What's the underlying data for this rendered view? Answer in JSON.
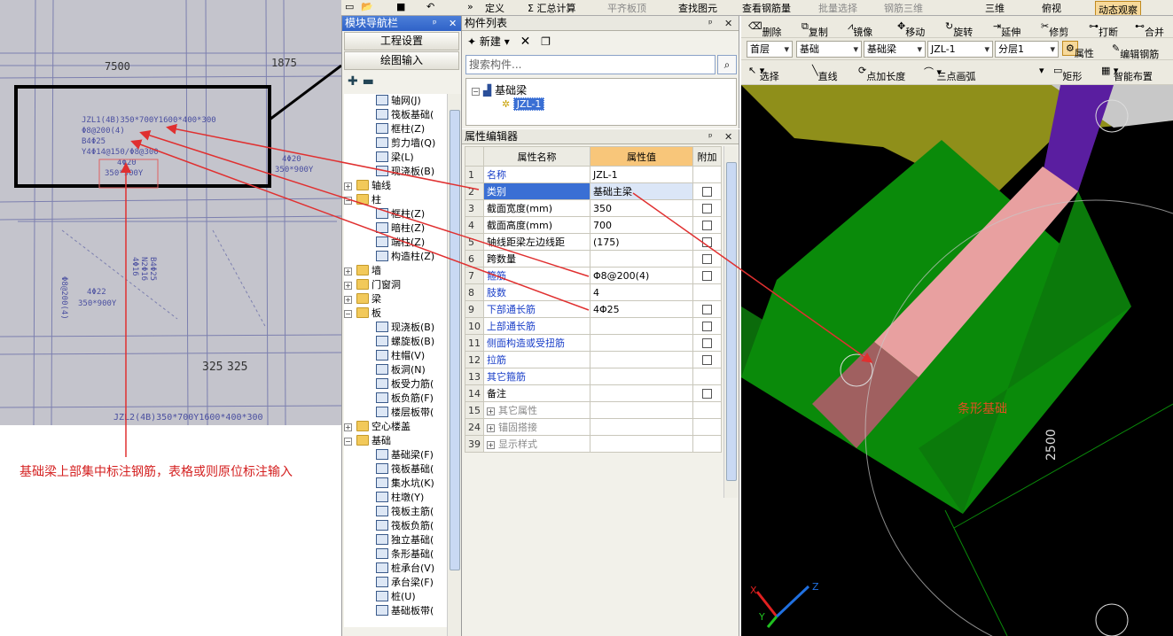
{
  "photo": {
    "dim_1": "7500",
    "dim_2": "1875",
    "beam_label_1": "JZL1(4B)350*700Y1600*400*300",
    "stirrup_1": "Φ8@200(4)",
    "bottom_bar_1": "B4Φ25",
    "haunch_1": "Y4Φ14@150/Φ8@300",
    "top_bar_1": "4Φ20",
    "section_1": "350*900Y",
    "top_bar_2": "4Φ20",
    "section_2": "350*900Y",
    "top_bar_3": "4Φ22",
    "section_3": "350*900Y",
    "side_1": "Φ8@200(4)",
    "side_2": "4Φ16",
    "side_3": "N2Φ16",
    "side_4": "B4Φ25",
    "dim_3": "325",
    "dim_4": "325",
    "beam_label_2": "JZL2(4B)350*700Y1600*400*300"
  },
  "caption": "基础梁上部集中标注钢筋，表格或则原位标注输入",
  "topbar": {
    "item_define": "定义",
    "item_sum": "Σ 汇总计算",
    "item_flat": "平齐板顶",
    "item_find": "查找图元",
    "item_view_rebar": "查看钢筋量",
    "item_batch": "批量选择",
    "item_rebar3d": "钢筋三维",
    "item_3d": "三维",
    "item_top": "俯视",
    "item_dynamic": "动态观察"
  },
  "nav": {
    "title": "模块导航栏",
    "btn_project": "工程设置",
    "btn_draw": "绘图输入",
    "items": [
      {
        "label": "轴网(J)",
        "level": 2,
        "kind": "tool"
      },
      {
        "label": "筏板基础(",
        "level": 2,
        "kind": "tool"
      },
      {
        "label": "框柱(Z)",
        "level": 2,
        "kind": "tool"
      },
      {
        "label": "剪力墙(Q)",
        "level": 2,
        "kind": "tool"
      },
      {
        "label": "梁(L)",
        "level": 2,
        "kind": "tool"
      },
      {
        "label": "现浇板(B)",
        "level": 2,
        "kind": "tool"
      },
      {
        "label": "轴线",
        "level": 1,
        "kind": "folder",
        "exp": "+"
      },
      {
        "label": "柱",
        "level": 1,
        "kind": "folder",
        "exp": "−"
      },
      {
        "label": "框柱(Z)",
        "level": 2,
        "kind": "tool"
      },
      {
        "label": "暗柱(Z)",
        "level": 2,
        "kind": "tool"
      },
      {
        "label": "端柱(Z)",
        "level": 2,
        "kind": "tool"
      },
      {
        "label": "构造柱(Z)",
        "level": 2,
        "kind": "tool"
      },
      {
        "label": "墙",
        "level": 1,
        "kind": "folder",
        "exp": "+"
      },
      {
        "label": "门窗洞",
        "level": 1,
        "kind": "folder",
        "exp": "+"
      },
      {
        "label": "梁",
        "level": 1,
        "kind": "folder",
        "exp": "+"
      },
      {
        "label": "板",
        "level": 1,
        "kind": "folder",
        "exp": "−"
      },
      {
        "label": "现浇板(B)",
        "level": 2,
        "kind": "tool"
      },
      {
        "label": "螺旋板(B)",
        "level": 2,
        "kind": "tool"
      },
      {
        "label": "柱帽(V)",
        "level": 2,
        "kind": "tool"
      },
      {
        "label": "板洞(N)",
        "level": 2,
        "kind": "tool"
      },
      {
        "label": "板受力筋(",
        "level": 2,
        "kind": "tool"
      },
      {
        "label": "板负筋(F)",
        "level": 2,
        "kind": "tool"
      },
      {
        "label": "楼层板带(",
        "level": 2,
        "kind": "tool"
      },
      {
        "label": "空心楼盖",
        "level": 1,
        "kind": "folder",
        "exp": "+"
      },
      {
        "label": "基础",
        "level": 1,
        "kind": "folder",
        "exp": "−"
      },
      {
        "label": "基础梁(F)",
        "level": 2,
        "kind": "tool"
      },
      {
        "label": "筏板基础(",
        "level": 2,
        "kind": "tool"
      },
      {
        "label": "集水坑(K)",
        "level": 2,
        "kind": "tool"
      },
      {
        "label": "柱墩(Y)",
        "level": 2,
        "kind": "tool"
      },
      {
        "label": "筏板主筋(",
        "level": 2,
        "kind": "tool"
      },
      {
        "label": "筏板负筋(",
        "level": 2,
        "kind": "tool"
      },
      {
        "label": "独立基础(",
        "level": 2,
        "kind": "tool"
      },
      {
        "label": "条形基础(",
        "level": 2,
        "kind": "tool"
      },
      {
        "label": "桩承台(V)",
        "level": 2,
        "kind": "tool"
      },
      {
        "label": "承台梁(F)",
        "level": 2,
        "kind": "tool"
      },
      {
        "label": "桩(U)",
        "level": 2,
        "kind": "tool"
      },
      {
        "label": "基础板带(",
        "level": 2,
        "kind": "tool"
      }
    ]
  },
  "complist": {
    "title": "构件列表",
    "new_label": "新建",
    "search_placeholder": "搜索构件...",
    "root": "基础梁",
    "child": "JZL-1"
  },
  "propedit": {
    "title": "属性编辑器",
    "col_name": "属性名称",
    "col_value": "属性值",
    "col_add": "附加",
    "rows": [
      {
        "num": "1",
        "name": "名称",
        "value": "JZL-1",
        "cb": false,
        "color": "blue"
      },
      {
        "num": "2",
        "name": "类别",
        "value": "基础主梁",
        "cb": true,
        "color": "blue",
        "sel": true
      },
      {
        "num": "3",
        "name": "截面宽度(mm)",
        "value": "350",
        "cb": true,
        "color": "black"
      },
      {
        "num": "4",
        "name": "截面高度(mm)",
        "value": "700",
        "cb": true,
        "color": "black"
      },
      {
        "num": "5",
        "name": "轴线距梁左边线距",
        "value": "(175)",
        "cb": true,
        "color": "black"
      },
      {
        "num": "6",
        "name": "跨数量",
        "value": "",
        "cb": true,
        "color": "black"
      },
      {
        "num": "7",
        "name": "箍筋",
        "value": "Φ8@200(4)",
        "cb": true,
        "color": "blue"
      },
      {
        "num": "8",
        "name": "肢数",
        "value": "4",
        "cb": false,
        "color": "blue"
      },
      {
        "num": "9",
        "name": "下部通长筋",
        "value": "4Φ25",
        "cb": true,
        "color": "blue"
      },
      {
        "num": "10",
        "name": "上部通长筋",
        "value": "",
        "cb": true,
        "color": "blue"
      },
      {
        "num": "11",
        "name": "侧面构造或受扭筋",
        "value": "",
        "cb": true,
        "color": "blue"
      },
      {
        "num": "12",
        "name": "拉筋",
        "value": "",
        "cb": true,
        "color": "blue"
      },
      {
        "num": "13",
        "name": "其它箍筋",
        "value": "",
        "cb": false,
        "color": "blue"
      },
      {
        "num": "14",
        "name": "备注",
        "value": "",
        "cb": true,
        "color": "black"
      },
      {
        "num": "15",
        "name": "其它属性",
        "value": "",
        "cb": false,
        "color": "grey",
        "group": true
      },
      {
        "num": "24",
        "name": "锚固搭接",
        "value": "",
        "cb": false,
        "color": "grey",
        "group": true
      },
      {
        "num": "39",
        "name": "显示样式",
        "value": "",
        "cb": false,
        "color": "grey",
        "group": true
      }
    ]
  },
  "toolbar2": {
    "delete": "删除",
    "copy": "复制",
    "mirror": "镜像",
    "move": "移动",
    "rotate": "旋转",
    "extend": "延伸",
    "trim": "修剪",
    "break": "打断",
    "merge": "合并",
    "floor": "首层",
    "category": "基础",
    "type": "基础梁",
    "component": "JZL-1",
    "layer": "分层1",
    "property": "属性",
    "edit_rebar": "编辑钢筋",
    "select": "选择",
    "line": "直线",
    "point_len": "点加长度",
    "arc3": "三点画弧",
    "rect": "矩形",
    "smart": "智能布置"
  },
  "view3d": {
    "strip_label": "条形基础",
    "dim": "2500",
    "axis_x": "X",
    "axis_y": "Y",
    "axis_z": "Z"
  },
  "colors": {
    "title_blue": "#2f62c8",
    "annotation_red": "#e03030",
    "footing_green": "#0a8a0a",
    "beam_pink": "#e89a9a",
    "purple": "#5a1ea0"
  }
}
